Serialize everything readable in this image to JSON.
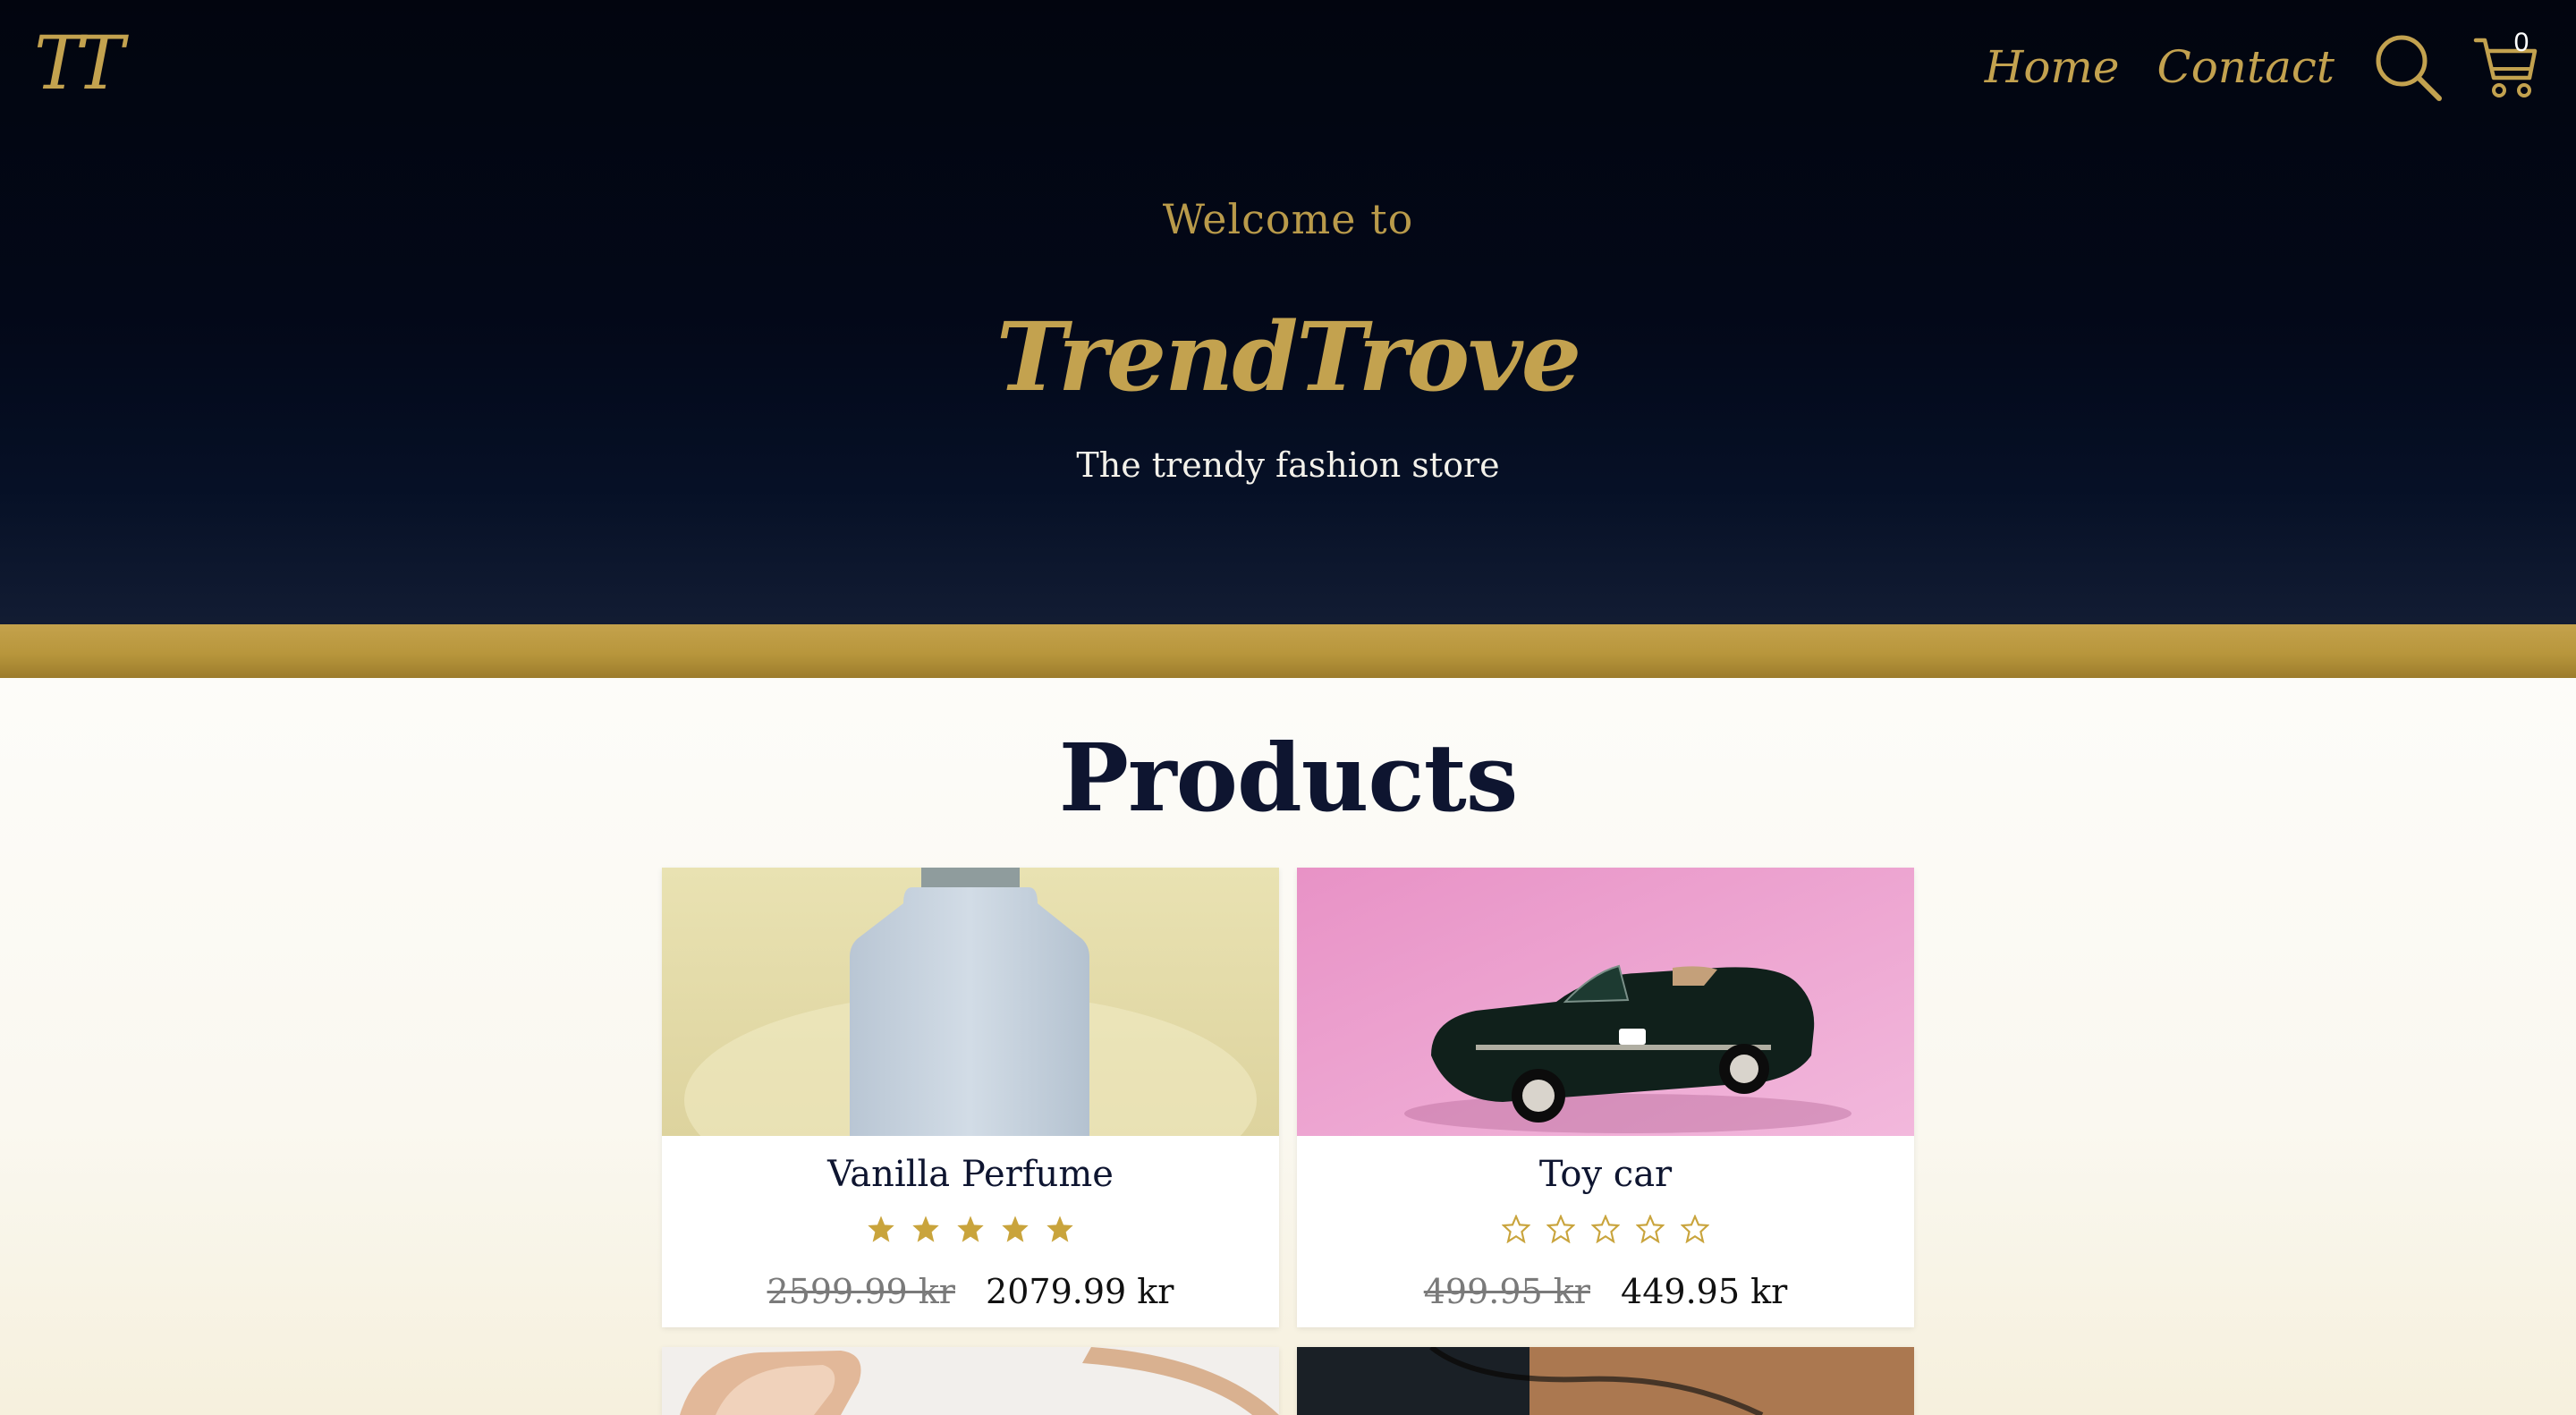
{
  "header": {
    "logo": "TT",
    "nav": [
      {
        "label": "Home"
      },
      {
        "label": "Contact"
      }
    ],
    "search_icon": "search-icon",
    "cart_icon": "cart-icon",
    "cart_count": "0"
  },
  "hero": {
    "welcome": "Welcome to",
    "brand": "TrendTrove",
    "tagline": "The trendy fashion store"
  },
  "products": {
    "title": "Products",
    "items": [
      {
        "name": "Vanilla Perfume",
        "rating": 5,
        "old_price": "2599.99 kr",
        "new_price": "2079.99 kr",
        "image": "perfume-bottle-image"
      },
      {
        "name": "Toy car",
        "rating": 0,
        "old_price": "499.95 kr",
        "new_price": "449.95 kr",
        "image": "toy-car-image"
      },
      {
        "name": "",
        "image": "headphones-image"
      },
      {
        "name": "",
        "image": "cable-image"
      }
    ]
  },
  "colors": {
    "navy": "#030818",
    "gold": "#c3a24f",
    "cream": "#fbf9f2"
  }
}
